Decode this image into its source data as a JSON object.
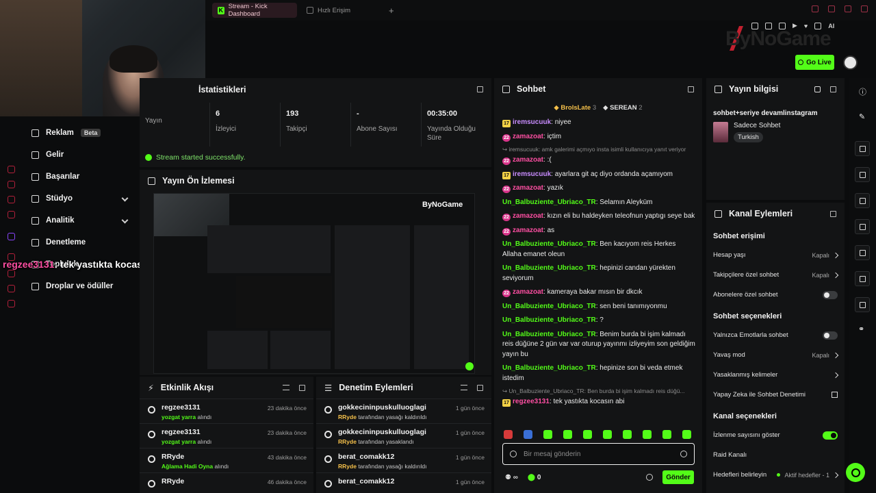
{
  "browser": {
    "tabs": [
      {
        "label": "Stream - Kick Dashboard"
      },
      {
        "label": "Hızlı Erişim"
      }
    ]
  },
  "brand": {
    "name": "ByNoGame",
    "go_live": "Go Live"
  },
  "nav": {
    "items": [
      {
        "label": "Reklam",
        "badge": "Beta"
      },
      {
        "label": "Gelir"
      },
      {
        "label": "Başarılar"
      },
      {
        "label": "Stüdyo"
      },
      {
        "label": "Analitik"
      },
      {
        "label": "Denetleme"
      },
      {
        "label": "Topluluk"
      },
      {
        "label": "Droplar ve ödüller"
      }
    ]
  },
  "overlay_chat": {
    "user": "regzee3131",
    "text": ": tek yastıkta kocasın abi"
  },
  "stats": {
    "title": "İstatistikleri",
    "items": [
      {
        "value": "",
        "label": "Yayın"
      },
      {
        "value": "6",
        "label": "İzleyici"
      },
      {
        "value": "193",
        "label": "Takipçi"
      },
      {
        "value": "-",
        "label": "Abone Sayısı"
      },
      {
        "value": "00:35:00",
        "label": "Yayında Olduğu Süre"
      }
    ],
    "status": "Stream started successfully."
  },
  "preview": {
    "title": "Yayın Ön İzlemesi"
  },
  "activity": {
    "title": "Etkinlik Akışı",
    "rows": [
      {
        "name": "regzee3131",
        "highlight": "yozgat yarra",
        "rest": "alındı",
        "time": "23 dakika önce"
      },
      {
        "name": "regzee3131",
        "highlight": "yozgat yarra",
        "rest": "alındı",
        "time": "23 dakika önce"
      },
      {
        "name": "RRyde",
        "highlight": "Ağlama Hadi Oyna",
        "rest": "alındı",
        "time": "43 dakika önce"
      },
      {
        "name": "RRyde",
        "highlight": "",
        "rest": "",
        "time": "46 dakika önce"
      }
    ]
  },
  "modlog": {
    "title": "Denetim Eylemleri",
    "rows": [
      {
        "name": "gokkecininpuskulluoglagi",
        "highlight": "RRyde",
        "rest": "tarafından yasağı kaldırıldı",
        "time": "1 gün önce"
      },
      {
        "name": "gokkecininpuskulluoglagi",
        "highlight": "RRyde",
        "rest": "tarafından yasaklandı",
        "time": "1 gün önce"
      },
      {
        "name": "berat_comakk12",
        "highlight": "RRyde",
        "rest": "tarafından yasağı kaldırıldı",
        "time": "1 gün önce"
      },
      {
        "name": "berat_comakk12",
        "highlight": "",
        "rest": "",
        "time": "1 gün önce"
      }
    ]
  },
  "chat": {
    "title": "Sohbet",
    "leaders": [
      {
        "name": "BrolsLate",
        "count": "3"
      },
      {
        "name": "SEREAN",
        "count": "2"
      }
    ],
    "messages": [
      {
        "badge": "17",
        "badge_type": "gold",
        "user": "iremsucuuk",
        "color": "purple",
        "text": ": niyee"
      },
      {
        "badge": "22",
        "badge_type": "pink",
        "user": "zamazoat",
        "color": "pink",
        "text": ": içtim"
      },
      {
        "reply": "↪ iremsucuuk: amk galerimi açmıyo insta isimli kullanıcıya yanıt veriyor"
      },
      {
        "badge": "22",
        "badge_type": "pink",
        "user": "zamazoat",
        "color": "pink",
        "text": ": :("
      },
      {
        "badge": "17",
        "badge_type": "gold",
        "user": "iremsucuuk",
        "color": "purple",
        "text": ": ayarlara git aç diyo ordanda açamıyom"
      },
      {
        "badge": "22",
        "badge_type": "pink",
        "user": "zamazoat",
        "color": "pink",
        "text": ": yazık"
      },
      {
        "badge": "",
        "user": "Un_Balbuziente_Ubriaco_TR",
        "color": "green",
        "text": ": Selamın Aleyküm"
      },
      {
        "badge": "22",
        "badge_type": "pink",
        "user": "zamazoat",
        "color": "pink",
        "text": ": kızın eli bu haldeyken teleofnun yaptıgı seye bak"
      },
      {
        "badge": "22",
        "badge_type": "pink",
        "user": "zamazoat",
        "color": "pink",
        "text": ": as"
      },
      {
        "badge": "",
        "user": "Un_Balbuziente_Ubriaco_TR",
        "color": "green",
        "text": ": Ben kacıyom reis Herkes Allaha emanet oleun"
      },
      {
        "badge": "",
        "user": "Un_Balbuziente_Ubriaco_TR",
        "color": "green",
        "text": ": hepinizi candan yürekten seviyorum"
      },
      {
        "badge": "22",
        "badge_type": "pink",
        "user": "zamazoat",
        "color": "pink",
        "text": ": kameraya bakar mısın bir dkcık"
      },
      {
        "badge": "",
        "user": "Un_Balbuziente_Ubriaco_TR",
        "color": "green",
        "text": ": sen beni tanımıyonmu"
      },
      {
        "badge": "",
        "user": "Un_Balbuziente_Ubriaco_TR",
        "color": "green",
        "text": ": ?"
      },
      {
        "badge": "",
        "user": "Un_Balbuziente_Ubriaco_TR",
        "color": "green",
        "text": ": Benim burda bi işim kalmadı reis düğüne 2 gün var var oturup yayınmı izliyeyim son geldiğim yayın bu"
      },
      {
        "badge": "",
        "user": "Un_Balbuziente_Ubriaco_TR",
        "color": "green",
        "text": ": hepinize son bi veda etmek istedim"
      },
      {
        "reply": "↪ Un_Balbuziente_Ubriaco_TR: Ben burda bi işim kalmadı reis düğü..."
      },
      {
        "badge": "17",
        "badge_type": "gold",
        "user": "regzee3131",
        "color": "pink",
        "text": ": tek yastıkta kocasın abi"
      }
    ],
    "input_placeholder": "Bir mesaj gönderin",
    "points": "0",
    "send": "Gönder",
    "emote_colors": [
      "#d63a3a",
      "#3a6fd6",
      "#53fc18",
      "#53fc18",
      "#53fc18",
      "#53fc18",
      "#53fc18",
      "#53fc18",
      "#53fc18",
      "#53fc18"
    ]
  },
  "info": {
    "title": "Yayın bilgisi",
    "stream_title": "sohbet+seriye devamlinstagram",
    "category": "Sadece Sohbet",
    "tag": "Turkish"
  },
  "actions": {
    "title": "Kanal Eylemleri",
    "sections": [
      {
        "title": "Sohbet erişimi",
        "rows": [
          {
            "label": "Hesap yaşı",
            "value": "Kapalı",
            "control": "chevron"
          },
          {
            "label": "Takipçilere özel sohbet",
            "value": "Kapalı",
            "control": "chevron"
          },
          {
            "label": "Abonelere özel sohbet",
            "value": "",
            "control": "toggle-off"
          }
        ]
      },
      {
        "title": "Sohbet seçenekleri",
        "rows": [
          {
            "label": "Yalnızca Emotlarla sohbet",
            "value": "",
            "control": "toggle-off"
          },
          {
            "label": "Yavaş mod",
            "value": "Kapalı",
            "control": "chevron"
          },
          {
            "label": "Yasaklanmış kelimeler",
            "value": "",
            "control": "chevron"
          },
          {
            "label": "Yapay Zeka ile Sohbet Denetimi",
            "value": "",
            "control": "external"
          }
        ]
      },
      {
        "title": "Kanal seçenekleri",
        "rows": [
          {
            "label": "İzlenme sayısını göster",
            "value": "",
            "control": "toggle-on"
          },
          {
            "label": "Raid Kanalı",
            "value": "",
            "control": "none"
          },
          {
            "label": "Hedefleri belirleyin",
            "value": "Aktif hedefler - 1",
            "control": "chevron-dot"
          }
        ]
      }
    ]
  }
}
